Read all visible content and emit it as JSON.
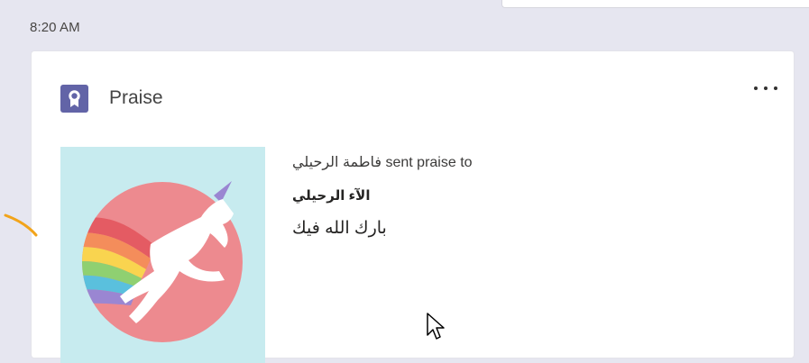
{
  "timestamp": "8:20 AM",
  "card": {
    "icon": "praise-badge-icon",
    "title": "Praise",
    "more_label": "•••",
    "image": "unicorn-badge-image",
    "sender_line": "فاطمة الرحيلي sent praise to",
    "recipient": "الآء الرحيلي",
    "message": "بارك الله فيك"
  },
  "colors": {
    "background": "#e6e6f0",
    "accent": "#6264a7",
    "image_background": "#c7ebef",
    "circle": "#ed8a8f",
    "annotation": "#f2a41a"
  }
}
